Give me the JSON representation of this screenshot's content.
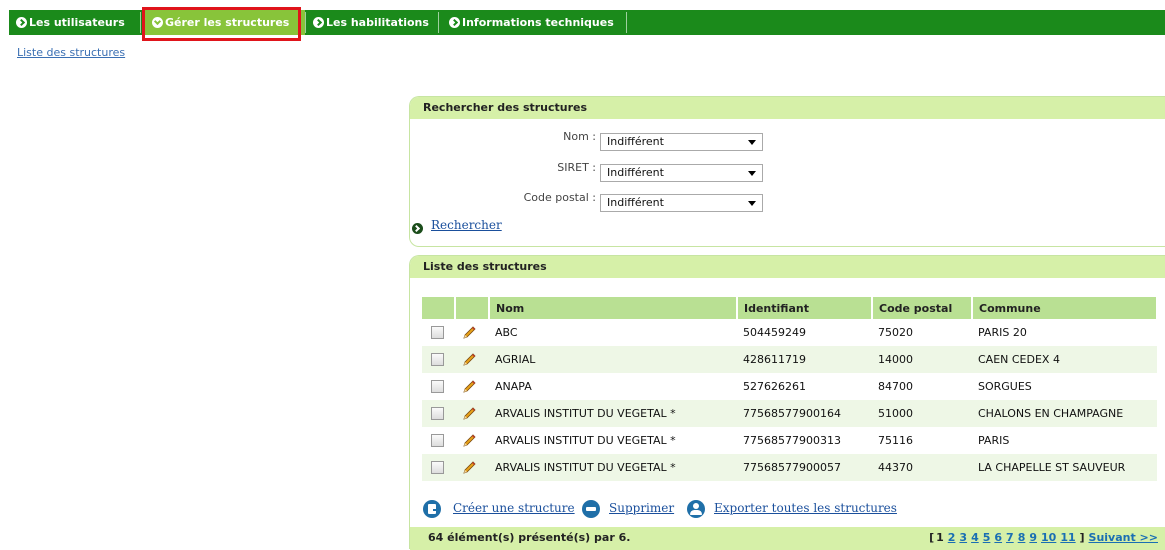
{
  "nav": {
    "items": [
      {
        "label": "Les utilisateurs"
      },
      {
        "label": "Gérer les structures"
      },
      {
        "label": "Les habilitations"
      },
      {
        "label": "Informations techniques"
      }
    ]
  },
  "breadcrumb": "Liste des structures",
  "search": {
    "title": "Rechercher des structures",
    "fields": [
      {
        "label": "Nom :",
        "value": "Indifférent"
      },
      {
        "label": "SIRET :",
        "value": "Indifférent"
      },
      {
        "label": "Code postal :",
        "value": "Indifférent"
      }
    ],
    "submit_label": "Rechercher"
  },
  "list": {
    "title": "Liste des structures",
    "columns": [
      "Nom",
      "Identifiant",
      "Code postal",
      "Commune"
    ],
    "rows": [
      {
        "nom": "ABC",
        "identifiant": "504459249",
        "code_postal": "75020",
        "commune": "PARIS 20"
      },
      {
        "nom": "AGRIAL",
        "identifiant": "428611719",
        "code_postal": "14000",
        "commune": "CAEN CEDEX 4"
      },
      {
        "nom": "ANAPA",
        "identifiant": "527626261",
        "code_postal": "84700",
        "commune": "SORGUES"
      },
      {
        "nom": "ARVALIS INSTITUT DU VEGETAL *",
        "identifiant": "77568577900164",
        "code_postal": "51000",
        "commune": "CHALONS EN CHAMPAGNE"
      },
      {
        "nom": "ARVALIS INSTITUT DU VEGETAL *",
        "identifiant": "77568577900313",
        "code_postal": "75116",
        "commune": "PARIS"
      },
      {
        "nom": "ARVALIS INSTITUT DU VEGETAL *",
        "identifiant": "77568577900057",
        "code_postal": "44370",
        "commune": "LA CHAPELLE ST SAUVEUR"
      }
    ],
    "actions": {
      "create": "Créer une structure",
      "delete": "Supprimer",
      "export": "Exporter toutes les structures"
    },
    "count_text": "64 élément(s) présenté(s) par 6.",
    "pager": {
      "open": "[",
      "current": "1",
      "pages": [
        "2",
        "3",
        "4",
        "5",
        "6",
        "7",
        "8",
        "9",
        "10",
        "11"
      ],
      "close": "]",
      "next": "Suivant >>"
    }
  },
  "colors": {
    "nav_bg": "#1b8a1b",
    "nav_active": "#88c43a",
    "panel_head": "#d6f0a8",
    "highlight": "#e0141b"
  }
}
